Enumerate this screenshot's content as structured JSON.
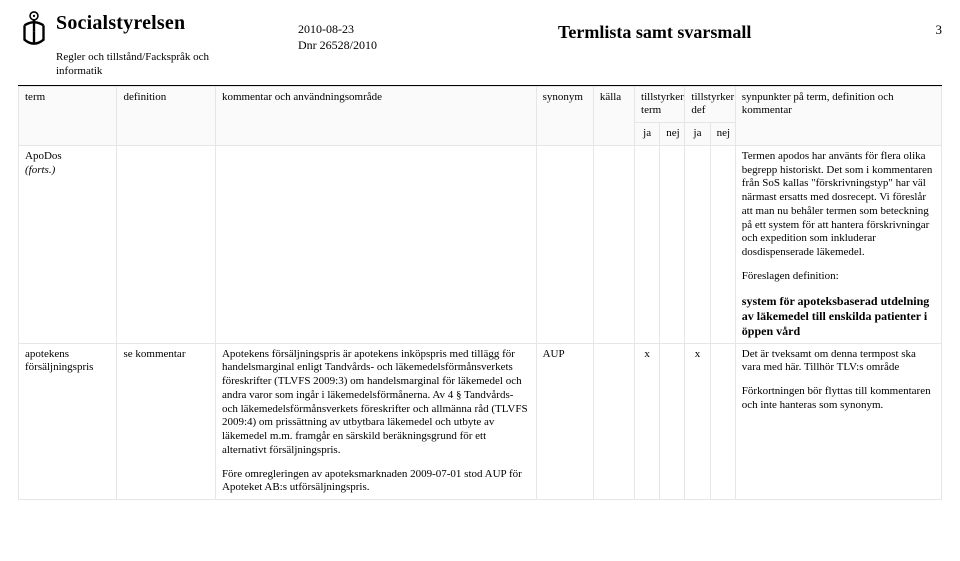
{
  "header": {
    "brand": "Socialstyrelsen",
    "subunit": "Regler och tillstånd/Fackspråk och informatik",
    "date": "2010-08-23",
    "diary": "Dnr 26528/2010",
    "title": "Termlista samt svarsmall",
    "page": "3"
  },
  "columns": {
    "term": "term",
    "definition": "definition",
    "kommentar": "kommentar och användningsområde",
    "synonym": "synonym",
    "kalla": "källa",
    "tillstyrker_term": "tillstyrker term",
    "tillstyrker_def": "tillstyrker def",
    "synpunkter": "synpunkter på term, definition och kommentar",
    "ja": "ja",
    "nej": "nej"
  },
  "rows": [
    {
      "term": "ApoDos",
      "term_note": "(forts.)",
      "definition": "",
      "kommentar": "",
      "synonym": "",
      "kalla": "",
      "term_ja": "",
      "term_nej": "",
      "def_ja": "",
      "def_nej": "",
      "synpunkter": "Termen apodos har använts för flera olika begrepp historiskt. Det som i kommentaren från SoS kallas \"förskrivningstyp\" har väl närmast ersatts med dosrecept. Vi föreslår att man nu behåler termen som beteckning på ett system för att hantera förskrivningar och expedition som inkluderar dosdispenserade läkemedel.",
      "synpunkter_p2_label": "Föreslagen definition:",
      "synpunkter_p3_bold": "system för apoteksbaserad utdelning av läkemedel till enskilda patienter i öppen vård"
    },
    {
      "term": "apotekens försäljningspris",
      "definition": "se kommentar",
      "kommentar": "Apotekens försäljningspris är apotekens inköpspris med tillägg för handelsmarginal enligt Tandvårds- och läkemedelsförmånsverkets föreskrifter (TLVFS 2009:3) om handelsmarginal för läkemedel och andra varor som ingår i läkemedelsförmånerna. Av 4 § Tandvårds- och läkemedelsförmånsverkets föreskrifter och allmänna råd (TLVFS 2009:4) om prissättning av utbytbara läkemedel och utbyte av läkemedel m.m. framgår en särskild beräkningsgrund för ett alternativt försäljningspris.",
      "kommentar_p2": "Före omregleringen av apoteksmarknaden 2009-07-01 stod AUP för Apoteket AB:s utförsäljningspris.",
      "synonym": "AUP",
      "kalla": "",
      "term_ja": "x",
      "term_nej": "",
      "def_ja": "x",
      "def_nej": "",
      "synpunkter": "Det är tveksamt om denna termpost ska vara med här. Tillhör TLV:s område",
      "synpunkter_p2": "Förkortningen bör flyttas till kommentaren och inte hanteras som synonym."
    }
  ]
}
